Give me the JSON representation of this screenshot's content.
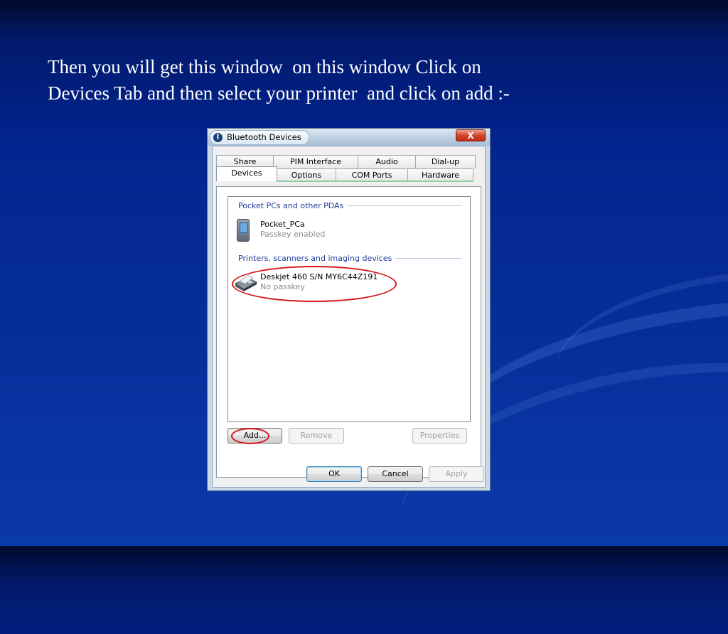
{
  "caption": {
    "line1": "Then you will get this window  on this window Click on",
    "line2": "Devices Tab and then select your printer  and click on add :-"
  },
  "window": {
    "title": "Bluetooth Devices",
    "close_label": "X",
    "title_icon": "bluetooth-icon"
  },
  "tabs": {
    "back_row": [
      "Share",
      "PIM Interface",
      "Audio",
      "Dial-up"
    ],
    "front_row": [
      "Devices",
      "Options",
      "COM Ports",
      "Hardware"
    ],
    "selected": "Devices"
  },
  "device_list": {
    "groups": [
      {
        "header": "Pocket PCs and other PDAs",
        "devices": [
          {
            "name": "Pocket_PCa",
            "status": "Passkey enabled",
            "icon": "pda-icon"
          }
        ]
      },
      {
        "header": "Printers, scanners and imaging devices",
        "devices": [
          {
            "name": "Deskjet 460 S/N MY6C44Z191",
            "status": "No passkey",
            "icon": "printer-icon"
          }
        ]
      }
    ]
  },
  "buttons": {
    "add": "Add...",
    "remove": "Remove",
    "properties": "Properties",
    "ok": "OK",
    "cancel": "Cancel",
    "apply": "Apply"
  },
  "colors": {
    "highlight": "#d4131b",
    "group_header": "#1e3c9a",
    "background": "#03248f"
  }
}
